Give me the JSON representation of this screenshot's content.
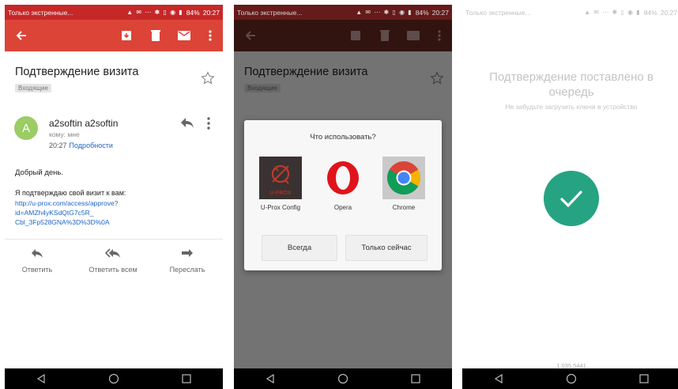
{
  "status": {
    "carrier": "Только экстренные...",
    "icons": "▲ ✉ ⋯ ✱ ▯ ◉ ▮",
    "battery": "84%",
    "time": "20:27"
  },
  "email": {
    "subject": "Подтверждение визита",
    "label": "Входящие",
    "sender": "a2softin a2softin",
    "avatar_letter": "A",
    "to": "кому: мне",
    "time": "20:27",
    "details_link": "Подробности",
    "greeting": "Добрый день.",
    "body_line": "Я подтверждаю свой визит к вам:",
    "url_lines": [
      "http://u-prox.com/access/approve?",
      "id=AMZh4yKSdQtG7c5R_",
      "Cbl_3Fp528GNA%3D%3D%0A"
    ],
    "actions": {
      "reply": "Ответить",
      "reply_all": "Ответить всем",
      "forward": "Переслать"
    }
  },
  "chooser": {
    "title": "Что использовать?",
    "apps": [
      {
        "name": "U-Prox Config",
        "icon": "u-prox-config-icon"
      },
      {
        "name": "Opera",
        "icon": "opera-icon"
      },
      {
        "name": "Chrome",
        "icon": "chrome-icon"
      }
    ],
    "always_button": "Всегда",
    "just_once_button": "Только сейчас",
    "uprox_logo_text": "U-PROX"
  },
  "confirmation": {
    "title": "Подтверждение поставлено в очередь",
    "subtitle": "Не забудьте загрузить ключи в устройство",
    "version": "1.035 5441"
  },
  "colors": {
    "appbar": "#db4437",
    "statusbar": "#c62828",
    "link": "#1e63c8",
    "check": "#26a382",
    "avatar": "#9ccc65"
  }
}
